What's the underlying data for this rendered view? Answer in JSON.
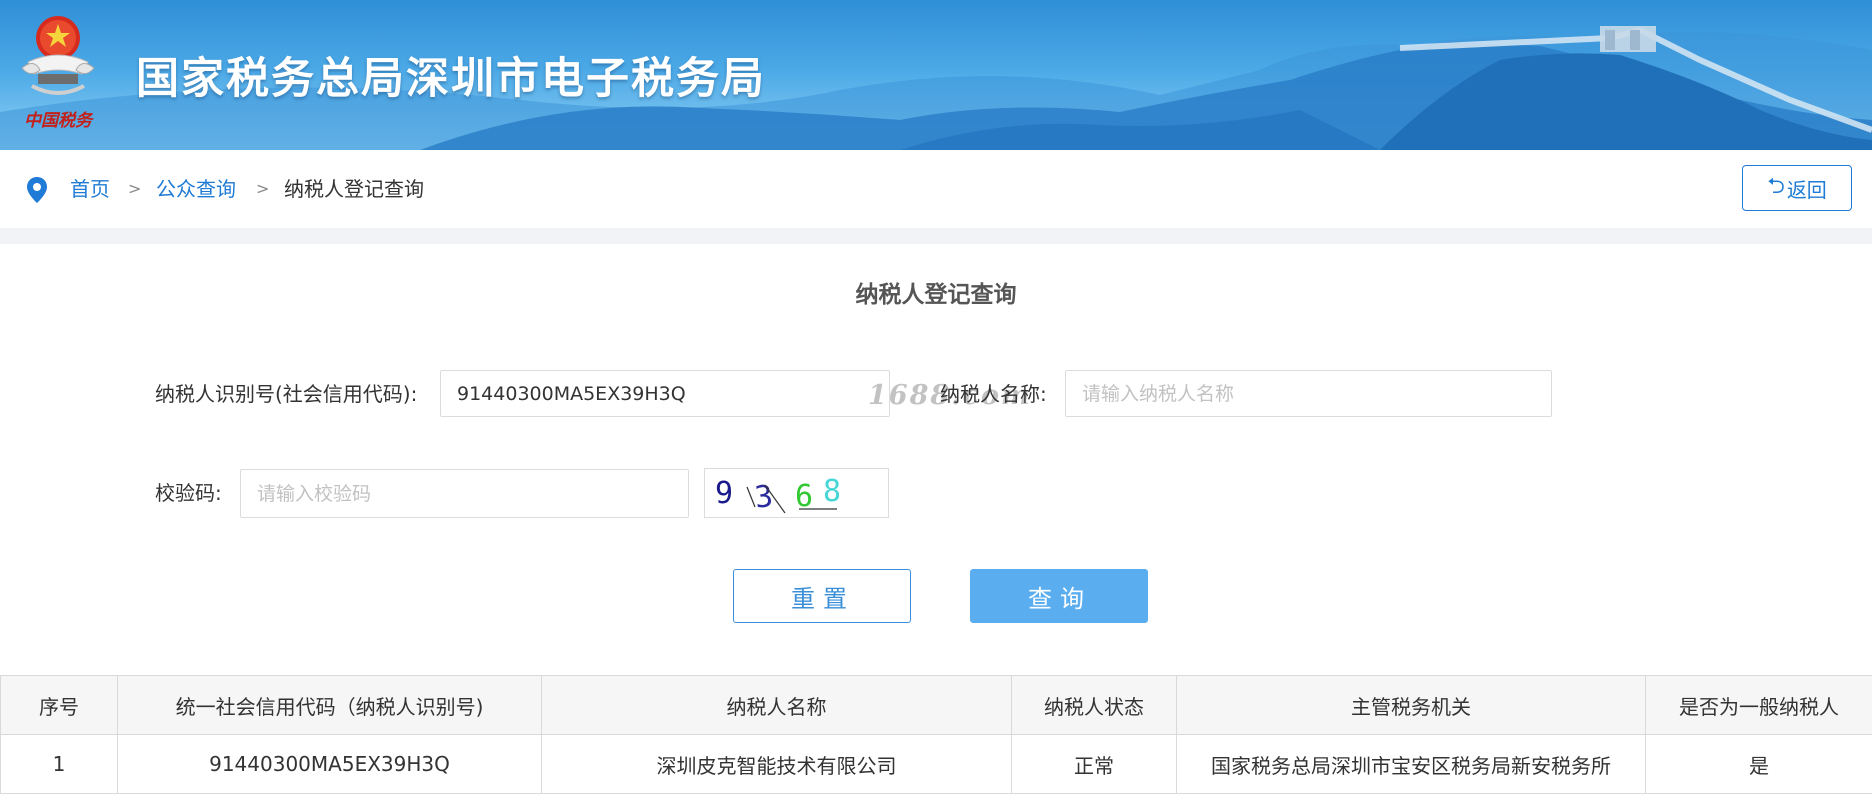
{
  "header": {
    "title": "国家税务总局深圳市电子税务局",
    "emblem_caption": "中国税务",
    "emblem_icon": "national-emblem-icon"
  },
  "breadcrumb": {
    "icon": "location-pin-icon",
    "items": [
      "首页",
      "公众查询",
      "纳税人登记查询"
    ],
    "separator": ">",
    "back_label": "返回",
    "back_icon": "undo-arrow-icon"
  },
  "form": {
    "title": "纳税人登记查询",
    "taxpayer_id_label": "纳税人识别号(社会信用代码):",
    "taxpayer_id_value": "91440300MA5EX39H3Q",
    "taxpayer_name_label": "纳税人名称:",
    "taxpayer_name_placeholder": "请输入纳税人名称",
    "captcha_label": "校验码:",
    "captcha_placeholder": "请输入校验码",
    "captcha_image_text": "9368",
    "watermark": "1688.com",
    "reset_label": "重置",
    "query_label": "查询"
  },
  "table": {
    "headers": [
      "序号",
      "统一社会信用代码（纳税人识别号)",
      "纳税人名称",
      "纳税人状态",
      "主管税务机关",
      "是否为一般纳税人"
    ],
    "rows": [
      [
        "1",
        "91440300MA5EX39H3Q",
        "深圳皮克智能技术有限公司",
        "正常",
        "国家税务总局深圳市宝安区税务局新安税务所",
        "是"
      ]
    ]
  },
  "colors": {
    "banner_blue": "#2f8fd6",
    "link_blue": "#1f7bd6",
    "query_button": "#5aaef0"
  }
}
